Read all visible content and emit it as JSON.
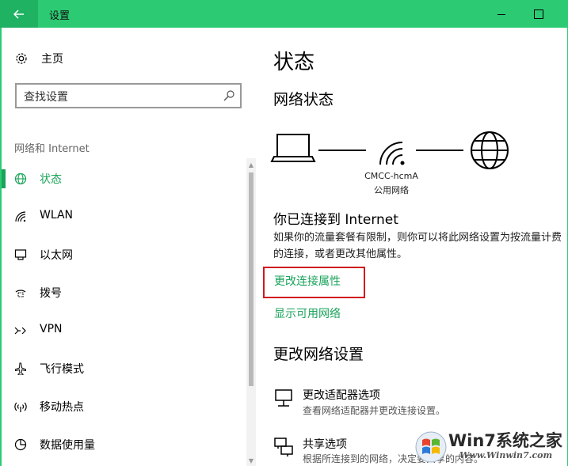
{
  "window": {
    "title": "设置"
  },
  "sidebar": {
    "home_label": "主页",
    "search_placeholder": "查找设置",
    "section_label": "网络和 Internet",
    "items": [
      {
        "label": "状态",
        "icon": "globe-icon"
      },
      {
        "label": "WLAN",
        "icon": "wifi-icon"
      },
      {
        "label": "以太网",
        "icon": "ethernet-icon"
      },
      {
        "label": "拨号",
        "icon": "dialup-icon"
      },
      {
        "label": "VPN",
        "icon": "vpn-icon"
      },
      {
        "label": "飞行模式",
        "icon": "airplane-icon"
      },
      {
        "label": "移动热点",
        "icon": "hotspot-icon"
      },
      {
        "label": "数据使用量",
        "icon": "data-usage-icon"
      }
    ]
  },
  "main": {
    "title": "状态",
    "network_status_heading": "网络状态",
    "network_name": "CMCC-hcmA",
    "network_type": "公用网络",
    "connected_heading": "你已连接到 Internet",
    "description": "如果你的流量套餐有限制，则你可以将此网络设置为按流量计费的连接，或者更改其他属性。",
    "link_change_properties": "更改连接属性",
    "link_show_networks": "显示可用网络",
    "change_settings_heading": "更改网络设置",
    "options": [
      {
        "title": "更改适配器选项",
        "desc": "查看网络适配器并更改连接设置。",
        "icon": "adapter-icon"
      },
      {
        "title": "共享选项",
        "desc": "根据所连接到的网络，决定要共享的内容。",
        "icon": "sharing-icon"
      }
    ]
  },
  "watermark": {
    "brand": "Win7系统之家",
    "url": "Www.Winwin7.com"
  },
  "colors": {
    "accent": "#2ccb73",
    "link": "#1aa35a",
    "highlight": "#d0181f"
  }
}
